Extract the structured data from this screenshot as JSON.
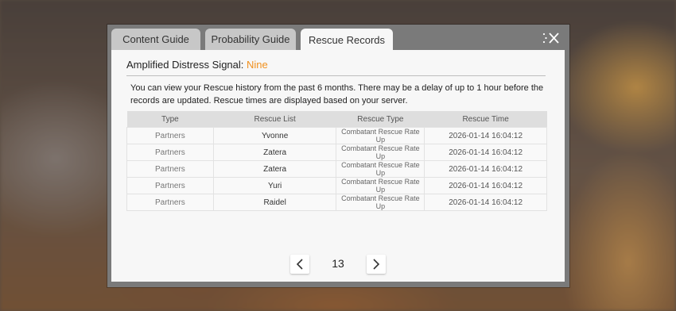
{
  "tabs": [
    {
      "label": "Content Guide"
    },
    {
      "label": "Probability Guide"
    },
    {
      "label": "Rescue Records"
    }
  ],
  "heading": {
    "prefix": "Amplified Distress Signal: ",
    "highlight": "Nine"
  },
  "description": "You can view your Rescue history from the past 6 months. There may be a delay of up to 1 hour before the records are updated. Rescue times are displayed based on your server.",
  "table": {
    "headers": [
      "Type",
      "Rescue List",
      "Rescue Type",
      "Rescue Time"
    ],
    "rows": [
      [
        "Partners",
        "Yvonne",
        "Combatant Rescue Rate Up",
        "2026-01-14 16:04:12"
      ],
      [
        "Partners",
        "Zatera",
        "Combatant Rescue Rate Up",
        "2026-01-14 16:04:12"
      ],
      [
        "Partners",
        "Zatera",
        "Combatant Rescue Rate Up",
        "2026-01-14 16:04:12"
      ],
      [
        "Partners",
        "Yuri",
        "Combatant Rescue Rate Up",
        "2026-01-14 16:04:12"
      ],
      [
        "Partners",
        "Raidel",
        "Combatant Rescue Rate Up",
        "2026-01-14 16:04:12"
      ]
    ]
  },
  "pagination": {
    "current_page": "13"
  },
  "icons": {
    "close": "close-icon",
    "prev": "chevron-left-icon",
    "next": "chevron-right-icon"
  },
  "colors": {
    "highlight": "#f0901e"
  }
}
